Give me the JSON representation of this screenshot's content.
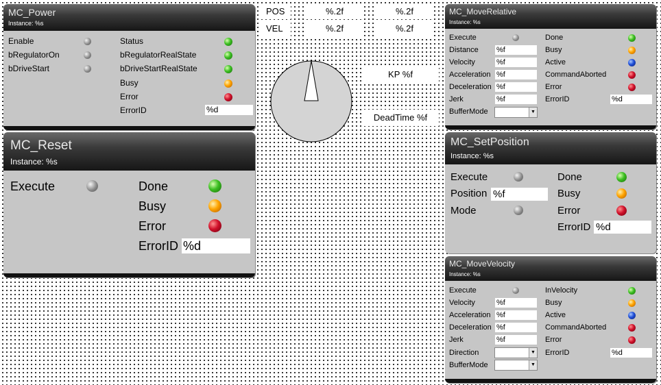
{
  "top_table": {
    "rows": [
      {
        "label": "POS",
        "v1": "%.2f",
        "v2": "%.2f"
      },
      {
        "label": "VEL",
        "v1": "%.2f",
        "v2": "%.2f"
      }
    ]
  },
  "kp_label": "KP %f",
  "deadtime_label": "DeadTime %f",
  "mc_power": {
    "title": "MC_Power",
    "instance": "Instance: %s",
    "enable": "Enable",
    "bregulatoron": "bRegulatorOn",
    "bdrivestart": "bDriveStart",
    "status": "Status",
    "bregulatorrealstate": "bRegulatorRealState",
    "bdrivestartrealstate": "bDriveStartRealState",
    "busy": "Busy",
    "error": "Error",
    "errorid": "ErrorID",
    "errorid_value": "%d"
  },
  "mc_reset": {
    "title": "MC_Reset",
    "instance": "Instance: %s",
    "execute": "Execute",
    "done": "Done",
    "busy": "Busy",
    "error": "Error",
    "errorid": "ErrorID",
    "errorid_value": "%d"
  },
  "mc_moverelative": {
    "title": "MC_MoveRelative",
    "instance": "Instance: %s",
    "execute": "Execute",
    "distance": "Distance",
    "velocity": "Velocity",
    "acceleration": "Acceleration",
    "deceleration": "Deceleration",
    "jerk": "Jerk",
    "buffermode": "BufferMode",
    "done": "Done",
    "busy": "Busy",
    "active": "Active",
    "commandaborted": "CommandAborted",
    "error": "Error",
    "errorid": "ErrorID",
    "field_value": "%f",
    "errorid_value": "%d"
  },
  "mc_setposition": {
    "title": "MC_SetPosition",
    "instance": "Instance: %s",
    "execute": "Execute",
    "position": "Position",
    "position_value": "%f",
    "mode": "Mode",
    "done": "Done",
    "busy": "Busy",
    "error": "Error",
    "errorid": "ErrorID",
    "errorid_value": "%d"
  },
  "mc_movevelocity": {
    "title": "MC_MoveVelocity",
    "instance": "Instance: %s",
    "execute": "Execute",
    "velocity": "Velocity",
    "acceleration": "Acceleration",
    "deceleration": "Deceleration",
    "jerk": "Jerk",
    "direction": "Direction",
    "buffermode": "BufferMode",
    "invelocity": "InVelocity",
    "busy": "Busy",
    "active": "Active",
    "commandaborted": "CommandAborted",
    "error": "Error",
    "errorid": "ErrorID",
    "field_value": "%f",
    "errorid_value": "%d"
  },
  "colors": {
    "panel_bg": "#c6c6c6",
    "header_dark": "#161616",
    "led_green": "#3cbf22",
    "led_orange": "#ffa400",
    "led_red": "#d0102a",
    "led_blue": "#1f4fd8",
    "led_gray": "#8a8a8a"
  }
}
